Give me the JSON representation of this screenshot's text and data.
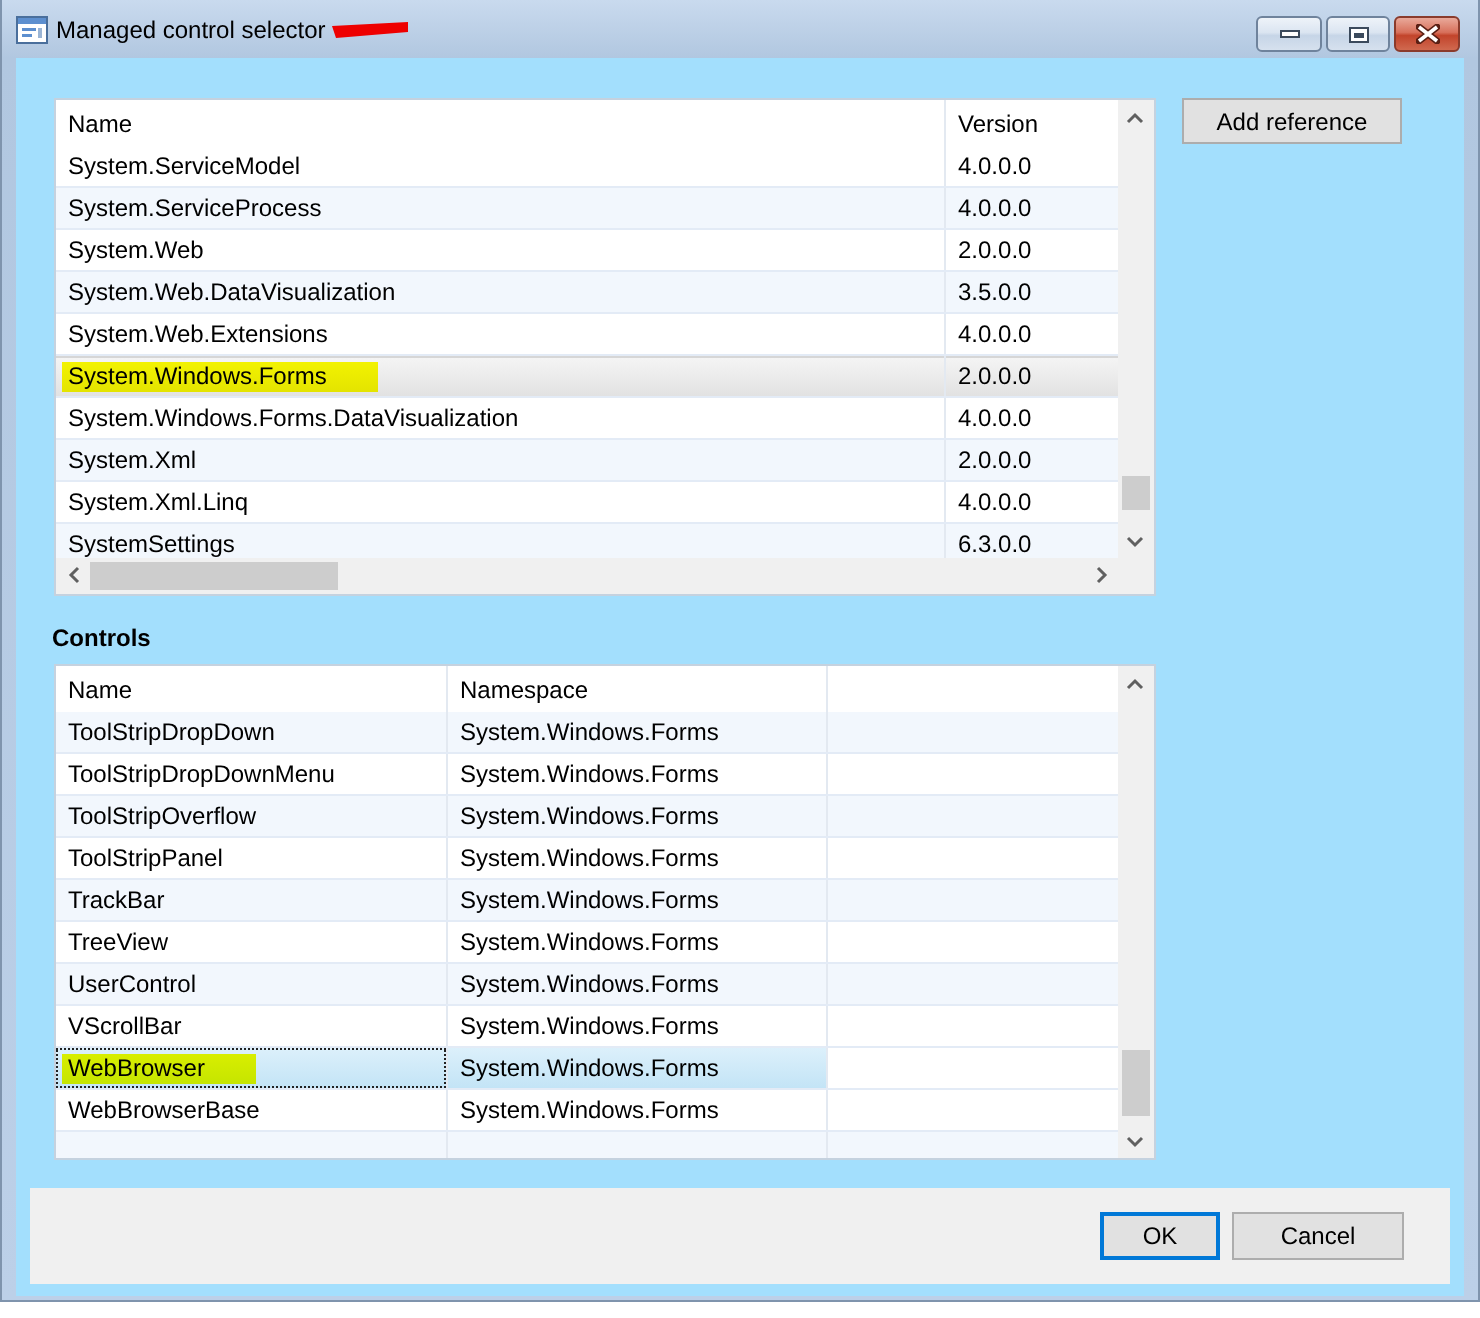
{
  "window": {
    "title": "Managed control selector"
  },
  "references": {
    "focused": false,
    "columns": [
      "Name",
      "Version"
    ],
    "rows": [
      {
        "name": "System.ServiceModel",
        "version": "4.0.0.0",
        "selected": false,
        "highlighted": false
      },
      {
        "name": "System.ServiceProcess",
        "version": "4.0.0.0",
        "selected": false,
        "highlighted": false
      },
      {
        "name": "System.Web",
        "version": "2.0.0.0",
        "selected": false,
        "highlighted": false
      },
      {
        "name": "System.Web.DataVisualization",
        "version": "3.5.0.0",
        "selected": false,
        "highlighted": false
      },
      {
        "name": "System.Web.Extensions",
        "version": "4.0.0.0",
        "selected": false,
        "highlighted": false
      },
      {
        "name": "System.Windows.Forms",
        "version": "2.0.0.0",
        "selected": true,
        "highlighted": true
      },
      {
        "name": "System.Windows.Forms.DataVisualization",
        "version": "4.0.0.0",
        "selected": false,
        "highlighted": false
      },
      {
        "name": "System.Xml",
        "version": "2.0.0.0",
        "selected": false,
        "highlighted": false
      },
      {
        "name": "System.Xml.Linq",
        "version": "4.0.0.0",
        "selected": false,
        "highlighted": false
      },
      {
        "name": "SystemSettings",
        "version": "6.3.0.0",
        "selected": false,
        "highlighted": false
      }
    ]
  },
  "add_reference_button": {
    "label": "Add reference"
  },
  "controls": {
    "label": "Controls",
    "focused": true,
    "columns": [
      "Name",
      "Namespace"
    ],
    "rows": [
      {
        "name": "ToolStripDropDown",
        "namespace": "System.Windows.Forms",
        "selected": false,
        "highlighted": false
      },
      {
        "name": "ToolStripDropDownMenu",
        "namespace": "System.Windows.Forms",
        "selected": false,
        "highlighted": false
      },
      {
        "name": "ToolStripOverflow",
        "namespace": "System.Windows.Forms",
        "selected": false,
        "highlighted": false
      },
      {
        "name": "ToolStripPanel",
        "namespace": "System.Windows.Forms",
        "selected": false,
        "highlighted": false
      },
      {
        "name": "TrackBar",
        "namespace": "System.Windows.Forms",
        "selected": false,
        "highlighted": false
      },
      {
        "name": "TreeView",
        "namespace": "System.Windows.Forms",
        "selected": false,
        "highlighted": false
      },
      {
        "name": "UserControl",
        "namespace": "System.Windows.Forms",
        "selected": false,
        "highlighted": false
      },
      {
        "name": "VScrollBar",
        "namespace": "System.Windows.Forms",
        "selected": false,
        "highlighted": false
      },
      {
        "name": "WebBrowser",
        "namespace": "System.Windows.Forms",
        "selected": true,
        "highlighted": true
      },
      {
        "name": "WebBrowserBase",
        "namespace": "System.Windows.Forms",
        "selected": false,
        "highlighted": false
      }
    ]
  },
  "buttons": [
    {
      "label": "OK",
      "default": true
    },
    {
      "label": "Cancel",
      "default": false
    }
  ]
}
